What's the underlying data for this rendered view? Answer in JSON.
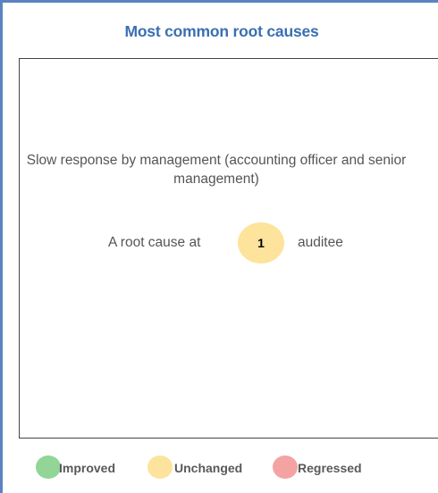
{
  "title": "Most common root causes",
  "root_cause": {
    "description": "Slow response by management (accounting officer and senior management)",
    "prefix": "A root cause at",
    "count": "1",
    "suffix": "auditee",
    "status_color": "#fde39b"
  },
  "legend": [
    {
      "label": "Improved",
      "color": "#92d597"
    },
    {
      "label": "Unchanged",
      "color": "#fde39b"
    },
    {
      "label": "Regressed",
      "color": "#f4a3a3"
    }
  ]
}
